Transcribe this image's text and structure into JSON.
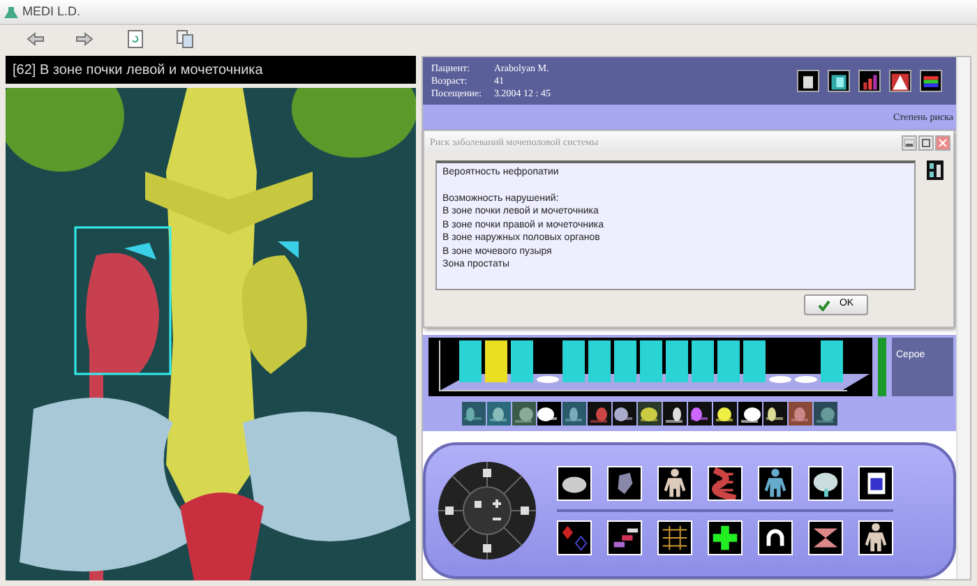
{
  "window": {
    "title": "MEDI L.D."
  },
  "view": {
    "title": "[62] В зоне почки левой и мочеточника"
  },
  "patient": [
    {
      "label": "Пациент:",
      "value": "Arabolyan M."
    },
    {
      "label": "Возраст:",
      "value": "41"
    },
    {
      "label": "Посещение:",
      "value": "3.2004  12 : 45"
    }
  ],
  "risk_label": "Степень риска",
  "dialog": {
    "title": "Риск заболеваний мочеполовой системы",
    "heading": "Вероятность нефропатии",
    "lines": [
      "Возможность нарушений:",
      "В зоне почки левой и мочеточника",
      "В зоне почки правой и мочеточника",
      "В зоне наружных половых органов",
      "В зоне мочевого пузыря",
      "Зона простаты"
    ],
    "ok": "OK"
  },
  "bars": [
    {
      "filled": true,
      "color": "#2ad4d4"
    },
    {
      "filled": true,
      "color": "#e8e020"
    },
    {
      "filled": true,
      "color": "#2ad4d4"
    },
    {
      "filled": false
    },
    {
      "filled": true,
      "color": "#2ad4d4"
    },
    {
      "filled": true,
      "color": "#2ad4d4"
    },
    {
      "filled": true,
      "color": "#2ad4d4"
    },
    {
      "filled": true,
      "color": "#2ad4d4"
    },
    {
      "filled": true,
      "color": "#2ad4d4"
    },
    {
      "filled": true,
      "color": "#2ad4d4"
    },
    {
      "filled": true,
      "color": "#2ad4d4"
    },
    {
      "filled": true,
      "color": "#2ad4d4"
    },
    {
      "filled": false
    },
    {
      "filled": false
    },
    {
      "filled": true,
      "color": "#2ad4d4"
    }
  ],
  "chart_side_label": "Серое"
}
